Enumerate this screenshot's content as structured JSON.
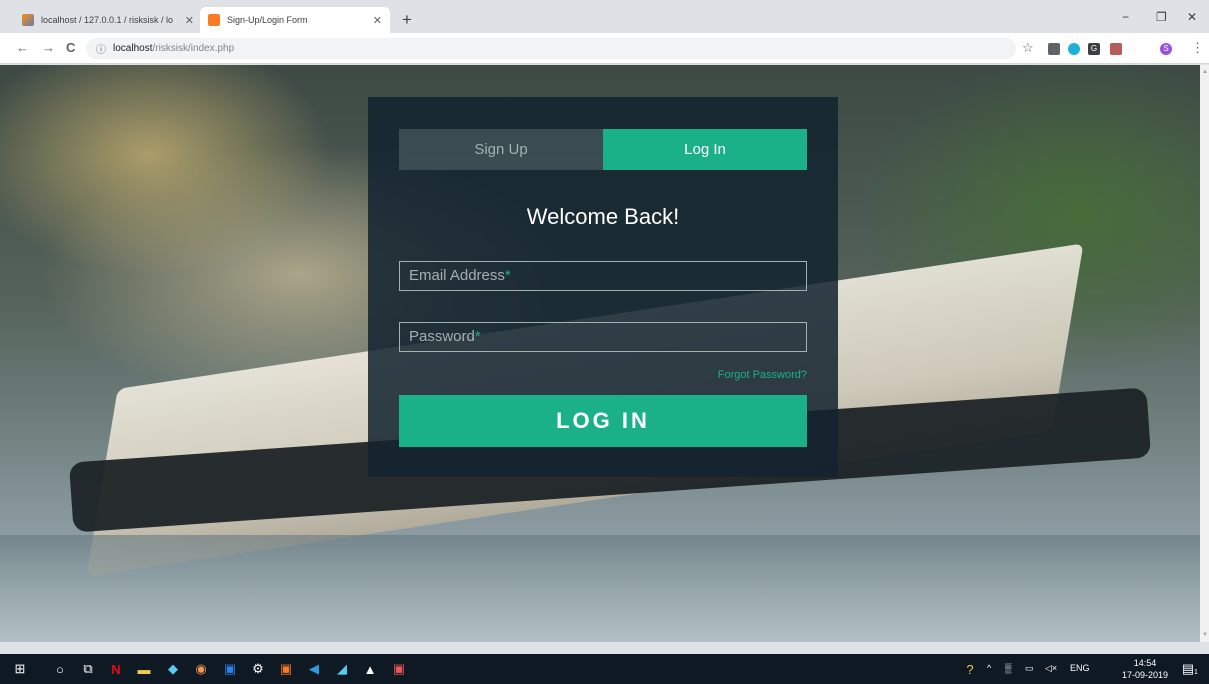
{
  "browser": {
    "tabs": [
      {
        "title": "localhost / 127.0.0.1 / risksisk / lo",
        "close": "✕",
        "favicon": "phpmyadmin-icon"
      },
      {
        "title": "Sign-Up/Login Form",
        "close": "✕",
        "favicon": "xampp-icon"
      }
    ],
    "new_tab": "+",
    "window_controls": {
      "minimize": "−",
      "maximize": "❐",
      "close": "✕"
    },
    "nav": {
      "back": "←",
      "forward": "→",
      "reload": "C"
    },
    "url_info": "ⓘ",
    "url_host": "localhost",
    "url_path": "/risksisk/index.php",
    "bookmark_star": "☆",
    "menu": "⋮",
    "profile_initial": "S",
    "extension_g": "G"
  },
  "form": {
    "tab_signup": "Sign Up",
    "tab_login": "Log In",
    "welcome": "Welcome Back!",
    "email_label": "Email Address",
    "password_label": "Password",
    "required_mark": "*",
    "forgot_password": "Forgot Password?",
    "login_button": "LOG IN"
  },
  "taskbar": {
    "language": "ENG",
    "time": "14:54",
    "date": "17-09-2019",
    "notification_count": "1"
  },
  "colors": {
    "accent": "#1ab188",
    "form_bg": "#13232f",
    "muted": "#a0b3b0"
  }
}
